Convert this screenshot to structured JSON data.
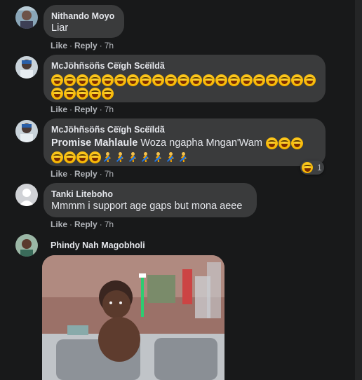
{
  "comments": [
    {
      "author": "Nithando Moyo",
      "text": "Liar",
      "like": "Like",
      "reply": "Reply",
      "time": "7h"
    },
    {
      "author": "McJöhñsöñs Cëïgh Scëïldã",
      "emoji_line1_count": 21,
      "emoji_line2_count": 5,
      "emoji_name": "laughing-face",
      "like": "Like",
      "reply": "Reply",
      "time": "7h"
    },
    {
      "author": "McJöhñsöñs Cëïgh Scëïldã",
      "mention": "Promise Mahlaule",
      "text": "Woza ngapha Mngan'Wam",
      "like": "Like",
      "reply": "Reply",
      "time": "7h",
      "reaction": {
        "icon": "laughing-face",
        "count": "1"
      }
    },
    {
      "author": "Tanki Liteboho",
      "text": "Mmmm i support age gaps but mona aeee",
      "like": "Like",
      "reply": "Reply",
      "time": "7h"
    },
    {
      "author": "Phindy Nah Magobholi",
      "attachment": "baby-in-sink-photo"
    }
  ],
  "colors": {
    "background": "#18191a",
    "bubble": "#3a3b3c",
    "text": "#e4e6eb",
    "secondary_text": "#b0b3b8"
  }
}
